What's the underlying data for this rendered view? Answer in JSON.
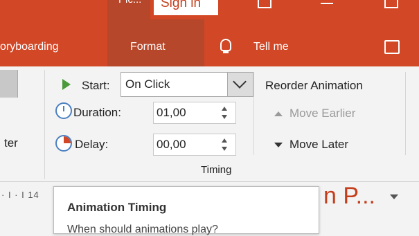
{
  "title_bar": {
    "app_tab": "Pic...",
    "sign_in": "Sign in"
  },
  "ribbon_tabs": {
    "storyboarding": "oryboarding",
    "format": "Format",
    "tell_me": "Tell me"
  },
  "left_group": {
    "partial_label": "ter"
  },
  "timing": {
    "start_label": "Start:",
    "start_value": "On Click",
    "duration_label": "Duration:",
    "duration_value": "01,00",
    "delay_label": "Delay:",
    "delay_value": "00,00",
    "group_label": "Timing"
  },
  "reorder": {
    "title": "Reorder Animation",
    "move_earlier": "Move Earlier",
    "move_later": "Move Later"
  },
  "ruler": {
    "text": "· I · I 14"
  },
  "document": {
    "title_fragment": "n P..."
  },
  "tooltip": {
    "title": "Animation Timing",
    "body": "When should animations play?"
  },
  "colors": {
    "ribbon_red": "#d24726",
    "selected_tab": "#b7472a",
    "play_green": "#4a9a3d",
    "clock_blue": "#4a7fc1"
  },
  "icons": [
    "minimize-icon",
    "restore-icon",
    "lightbulb-icon",
    "share-icon",
    "play-icon",
    "clock-icon",
    "delay-clock-icon",
    "spinner-up-icon",
    "spinner-down-icon",
    "triangle-up-icon",
    "triangle-down-icon"
  ]
}
